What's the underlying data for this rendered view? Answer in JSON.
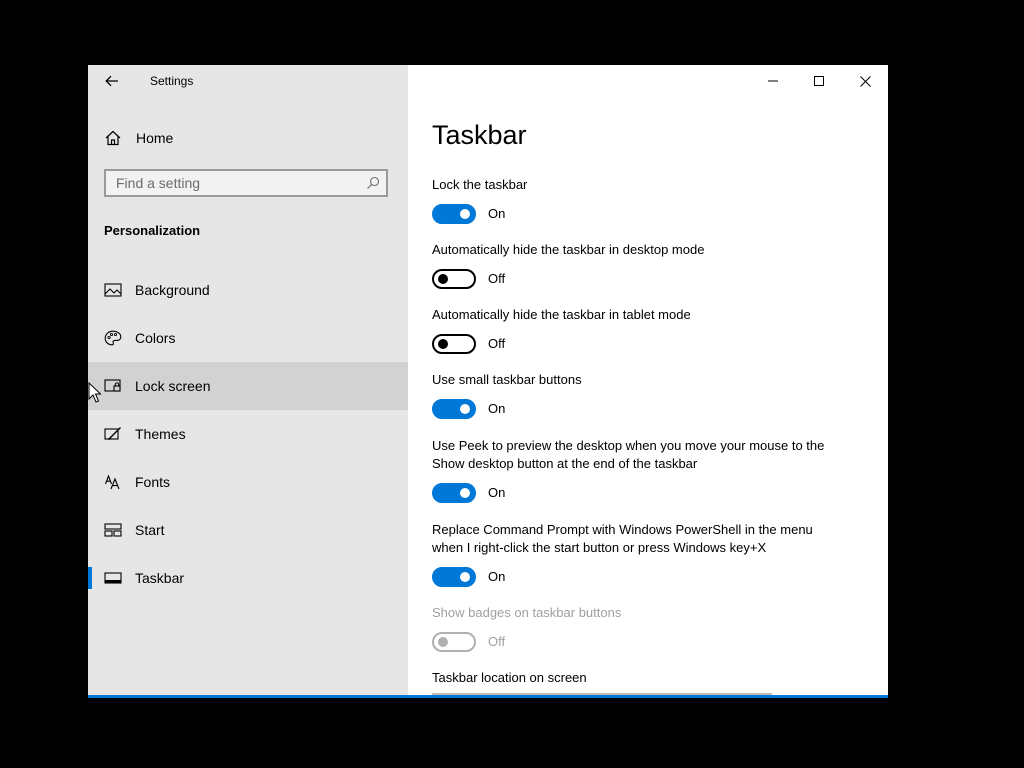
{
  "window": {
    "title": "Settings"
  },
  "sidebar": {
    "home_label": "Home",
    "search_placeholder": "Find a setting",
    "section_heading": "Personalization",
    "items": [
      {
        "label": "Background",
        "icon": "picture-icon"
      },
      {
        "label": "Colors",
        "icon": "palette-icon"
      },
      {
        "label": "Lock screen",
        "icon": "lock-screen-icon",
        "hovered": true
      },
      {
        "label": "Themes",
        "icon": "brush-icon"
      },
      {
        "label": "Fonts",
        "icon": "fonts-icon"
      },
      {
        "label": "Start",
        "icon": "start-icon"
      },
      {
        "label": "Taskbar",
        "icon": "taskbar-icon",
        "selected": true
      }
    ]
  },
  "main": {
    "title": "Taskbar",
    "settings": [
      {
        "label": "Lock the taskbar",
        "state": "On"
      },
      {
        "label": "Automatically hide the taskbar in desktop mode",
        "state": "Off"
      },
      {
        "label": "Automatically hide the taskbar in tablet mode",
        "state": "Off"
      },
      {
        "label": "Use small taskbar buttons",
        "state": "On"
      },
      {
        "label_line1": "Use Peek to preview the desktop when you move your mouse to the",
        "label_line2": "Show desktop button at the end of the taskbar",
        "state": "On"
      },
      {
        "label_line1": "Replace Command Prompt with Windows PowerShell in the menu",
        "label_line2": "when I right-click the start button or press Windows key+X",
        "state": "On"
      },
      {
        "label": "Show badges on taskbar buttons",
        "state": "Off",
        "disabled": true
      }
    ],
    "location_label": "Taskbar location on screen"
  },
  "colors": {
    "accent": "#0078d7",
    "sidebar_bg": "#e6e6e6",
    "hover_bg": "#d2d2d2",
    "disabled_text": "#a0a0a0"
  }
}
